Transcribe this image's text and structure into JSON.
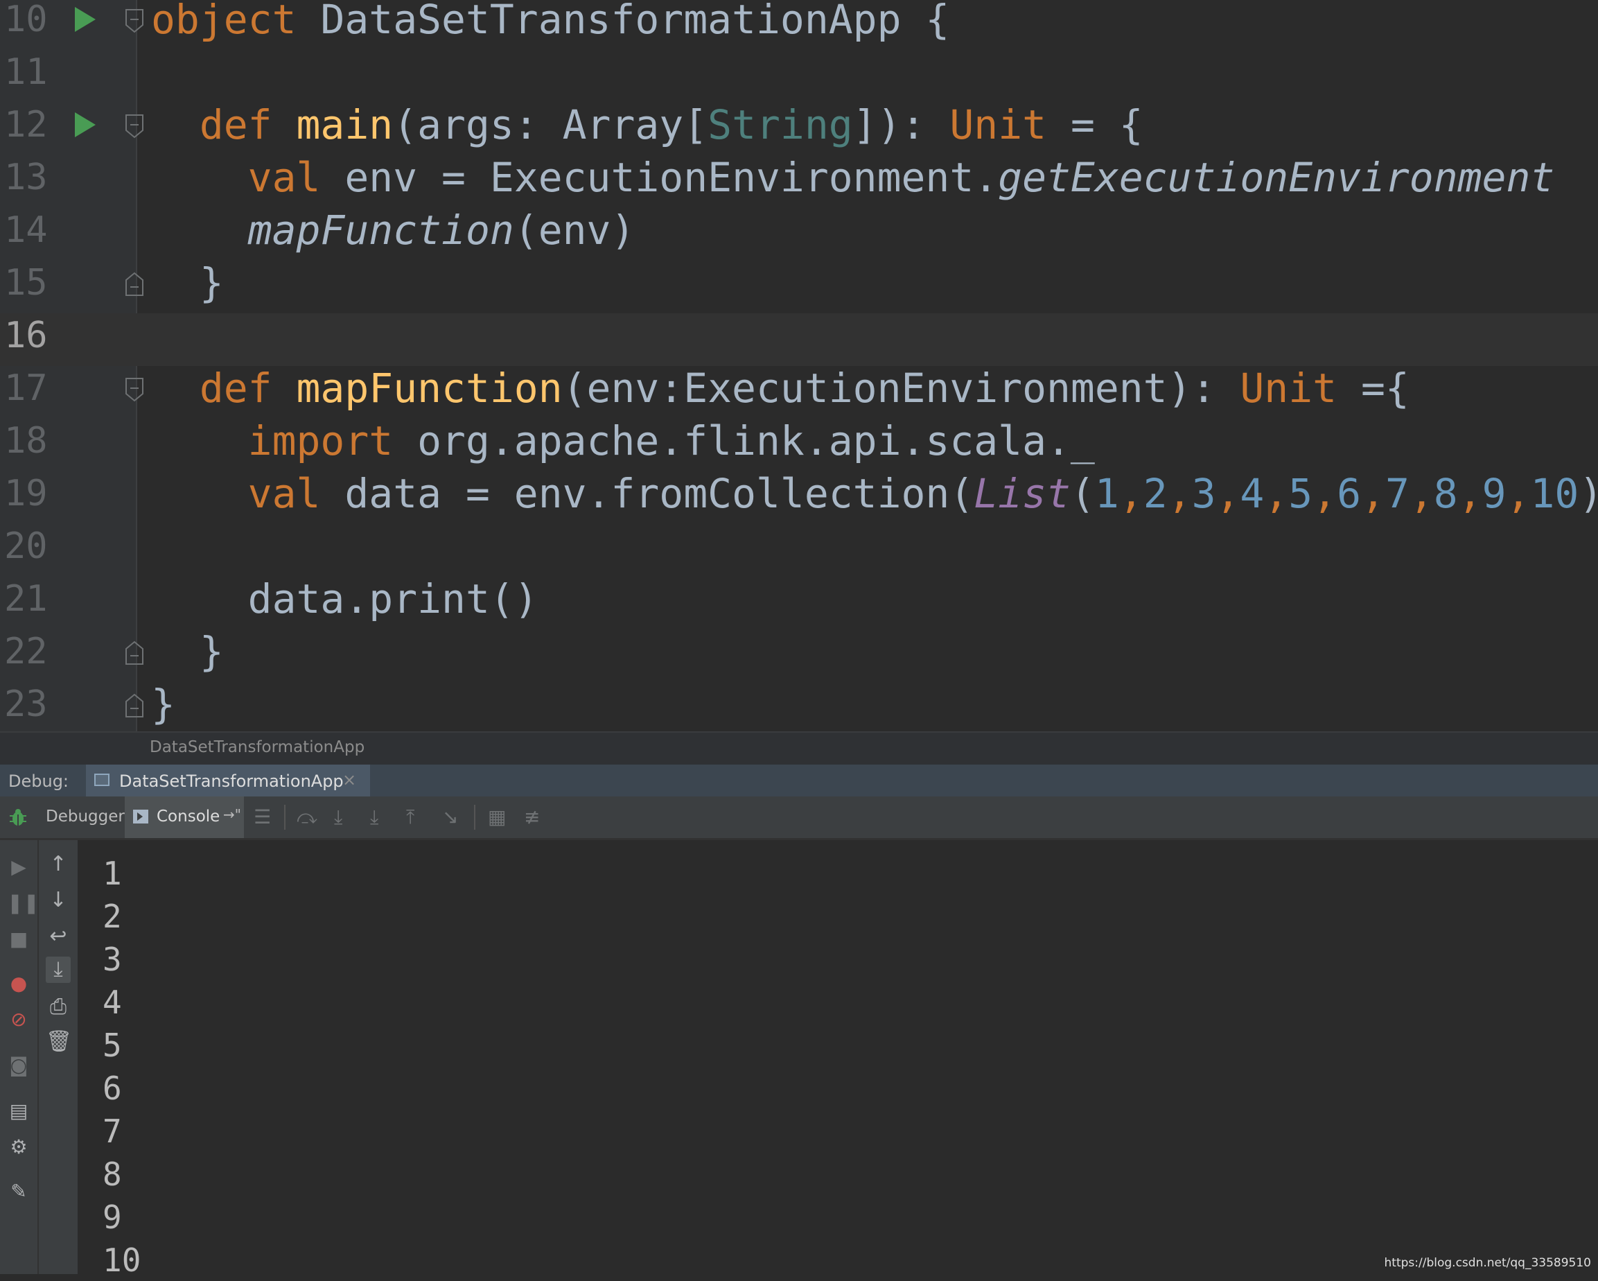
{
  "editor": {
    "lines": [
      {
        "num": "10",
        "run": true,
        "fold": "open",
        "tokens": [
          {
            "t": "object ",
            "c": "kw"
          },
          {
            "t": "DataSetTransformationApp {",
            "c": "ty"
          }
        ]
      },
      {
        "num": "11",
        "tokens": []
      },
      {
        "num": "12",
        "run": true,
        "fold": "open",
        "tokens": [
          {
            "t": "  def ",
            "c": "kw"
          },
          {
            "t": "main",
            "c": "fn"
          },
          {
            "t": "(args: Array[",
            "c": "ty"
          },
          {
            "t": "String",
            "c": "str-ty"
          },
          {
            "t": "]): ",
            "c": "ty"
          },
          {
            "t": "Unit",
            "c": "kw"
          },
          {
            "t": " = {",
            "c": "ty"
          }
        ]
      },
      {
        "num": "13",
        "tokens": [
          {
            "t": "    val ",
            "c": "kw"
          },
          {
            "t": "env = ExecutionEnvironment.",
            "c": "ty"
          },
          {
            "t": "getExecutionEnvironment",
            "c": "ty it"
          }
        ]
      },
      {
        "num": "14",
        "tokens": [
          {
            "t": "    ",
            "c": "ty"
          },
          {
            "t": "mapFunction",
            "c": "ty it"
          },
          {
            "t": "(env)",
            "c": "ty"
          }
        ]
      },
      {
        "num": "15",
        "fold": "close",
        "tokens": [
          {
            "t": "  }",
            "c": "ty"
          }
        ]
      },
      {
        "num": "16",
        "current": true,
        "tokens": []
      },
      {
        "num": "17",
        "fold": "open",
        "tokens": [
          {
            "t": "  def ",
            "c": "kw"
          },
          {
            "t": "mapFunction",
            "c": "fn"
          },
          {
            "t": "(env:ExecutionEnvironment): ",
            "c": "ty"
          },
          {
            "t": "Unit",
            "c": "kw"
          },
          {
            "t": " ={",
            "c": "ty"
          }
        ]
      },
      {
        "num": "18",
        "tokens": [
          {
            "t": "    import ",
            "c": "kw"
          },
          {
            "t": "org.apache.flink.api.scala._",
            "c": "ty"
          }
        ]
      },
      {
        "num": "19",
        "tokens": [
          {
            "t": "    val ",
            "c": "kw"
          },
          {
            "t": "data = env.fromCollection(",
            "c": "ty"
          },
          {
            "t": "List",
            "c": "purple"
          },
          {
            "t": "(",
            "c": "ty"
          },
          {
            "t": "1",
            "c": "num"
          },
          {
            "t": ",",
            "c": "comma"
          },
          {
            "t": "2",
            "c": "num"
          },
          {
            "t": ",",
            "c": "comma"
          },
          {
            "t": "3",
            "c": "num"
          },
          {
            "t": ",",
            "c": "comma"
          },
          {
            "t": "4",
            "c": "num"
          },
          {
            "t": ",",
            "c": "comma"
          },
          {
            "t": "5",
            "c": "num"
          },
          {
            "t": ",",
            "c": "comma"
          },
          {
            "t": "6",
            "c": "num"
          },
          {
            "t": ",",
            "c": "comma"
          },
          {
            "t": "7",
            "c": "num"
          },
          {
            "t": ",",
            "c": "comma"
          },
          {
            "t": "8",
            "c": "num"
          },
          {
            "t": ",",
            "c": "comma"
          },
          {
            "t": "9",
            "c": "num"
          },
          {
            "t": ",",
            "c": "comma"
          },
          {
            "t": "10",
            "c": "num"
          },
          {
            "t": "))",
            "c": "ty"
          }
        ]
      },
      {
        "num": "20",
        "tokens": []
      },
      {
        "num": "21",
        "tokens": [
          {
            "t": "    data.print()",
            "c": "ty"
          }
        ]
      },
      {
        "num": "22",
        "fold": "close",
        "tokens": [
          {
            "t": "  }",
            "c": "ty"
          }
        ]
      },
      {
        "num": "23",
        "fold": "close",
        "tokens": [
          {
            "t": "}",
            "c": "ty"
          }
        ]
      }
    ]
  },
  "breadcrumb": "DataSetTransformationApp",
  "debug": {
    "label": "Debug:",
    "tab_label": "DataSetTransformationApp",
    "close_glyph": "×",
    "debugger_tab": "Debugger",
    "console_tab": "Console",
    "console_pin": "→\"",
    "output": [
      "1",
      "2",
      "3",
      "4",
      "5",
      "6",
      "7",
      "8",
      "9",
      "10"
    ]
  },
  "watermark": "https://blog.csdn.net/qq_33589510",
  "colors": {
    "keyword": "#cc7832",
    "function": "#ffc66d",
    "number": "#6897bb",
    "run_icon": "#499c54"
  }
}
